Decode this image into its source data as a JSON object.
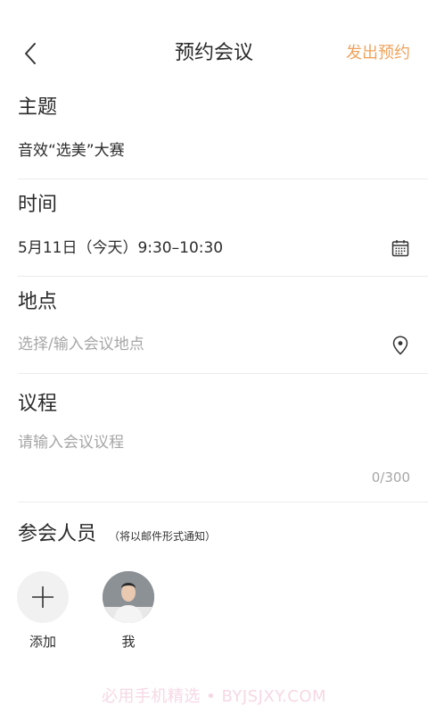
{
  "nav": {
    "title": "预约会议",
    "action": "发出预约",
    "back_icon": "chevron-left-icon"
  },
  "topic": {
    "label": "主题",
    "value": "音效“选美”大赛"
  },
  "time": {
    "label": "时间",
    "value": "5月11日（今天）9:30–10:30",
    "icon": "calendar-icon"
  },
  "location": {
    "label": "地点",
    "placeholder": "选择/输入会议地点",
    "icon": "location-pin-icon"
  },
  "agenda": {
    "label": "议程",
    "placeholder": "请输入会议议程",
    "counter": "0/300"
  },
  "attendees": {
    "label": "参会人员",
    "note": "（将以邮件形式通知）",
    "add_label": "添加",
    "me_label": "我"
  },
  "watermark": "必用手机精选 • BYJSJXY.COM",
  "colors": {
    "accent": "#f0a35c",
    "placeholder": "#a6a6a6",
    "divider": "#ececec"
  }
}
